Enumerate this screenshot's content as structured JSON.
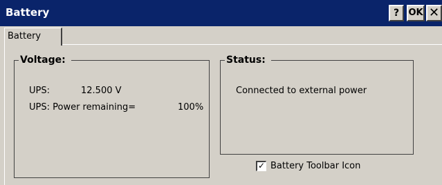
{
  "window": {
    "title": "Battery",
    "help_label": "?",
    "ok_label": "OK",
    "close_label": "✕"
  },
  "tabs": [
    {
      "label": "Battery",
      "active": true
    }
  ],
  "voltage": {
    "legend": "Voltage:",
    "ups_label": "UPS:",
    "ups_value": "12.500 V",
    "power_label": "UPS: Power remaining=",
    "power_value": "100%",
    "power_percent": 100
  },
  "status": {
    "legend": "Status:",
    "text": "Connected to external power"
  },
  "options": {
    "toolbar_icon_label": "Battery Toolbar Icon",
    "toolbar_icon_checked": true,
    "check_glyph": "✓"
  }
}
